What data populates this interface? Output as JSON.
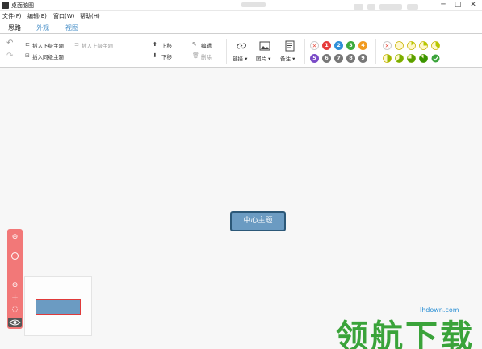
{
  "window": {
    "app_title": "桌面脑图",
    "icon": "app-logo-icon",
    "controls": {
      "minimize": "─",
      "maximize": "□",
      "close": "✕"
    }
  },
  "menu": {
    "items": [
      "文件(F)",
      "编辑(E)",
      "窗口(W)",
      "帮助(H)"
    ]
  },
  "tabs": [
    {
      "label": "思路",
      "active": true
    },
    {
      "label": "外观",
      "active": false
    },
    {
      "label": "视图",
      "active": false
    }
  ],
  "ribbon": {
    "undo_icon": "undo-icon",
    "redo_icon": "redo-icon",
    "insert_child": "插入下级主题",
    "insert_parent": "插入上级主题",
    "insert_sibling": "插入同级主题",
    "move_up": "上移",
    "move_down": "下移",
    "edit": "编辑",
    "delete": "删除",
    "link": "链接",
    "image": "图片",
    "note": "备注",
    "priority_row1": [
      "✕",
      "1",
      "2",
      "3",
      "4"
    ],
    "priority_row2": [
      "5",
      "6",
      "7",
      "8",
      "9"
    ],
    "priority_colors": [
      "#e84c3d",
      "#e63b3b",
      "#2f8fd8",
      "#3daa3d",
      "#f19a1f",
      "#7a4bc7",
      "#777777",
      "#777777",
      "#777777",
      "#777777"
    ],
    "progress_icons": [
      "progress-none-icon",
      "progress-0-icon",
      "progress-12-icon",
      "progress-25-icon",
      "progress-37-icon",
      "progress-50-icon",
      "progress-62-icon",
      "progress-75-icon",
      "progress-87-icon",
      "progress-done-icon"
    ]
  },
  "canvas": {
    "central_topic": "中心主题"
  },
  "zoom": {
    "zoom_in": "⊕",
    "zoom_out": "⊖",
    "fit": "✛",
    "reset": "◌",
    "level": 0.3
  },
  "watermark": {
    "site": "lhdown.com",
    "text": "领航下载"
  },
  "colors": {
    "accent": "#4a90c8",
    "topic_fill": "#6b9bc2",
    "topic_border": "#2c5878",
    "zoom_panel": "#f27878",
    "watermark_green": "#3aa33a"
  }
}
